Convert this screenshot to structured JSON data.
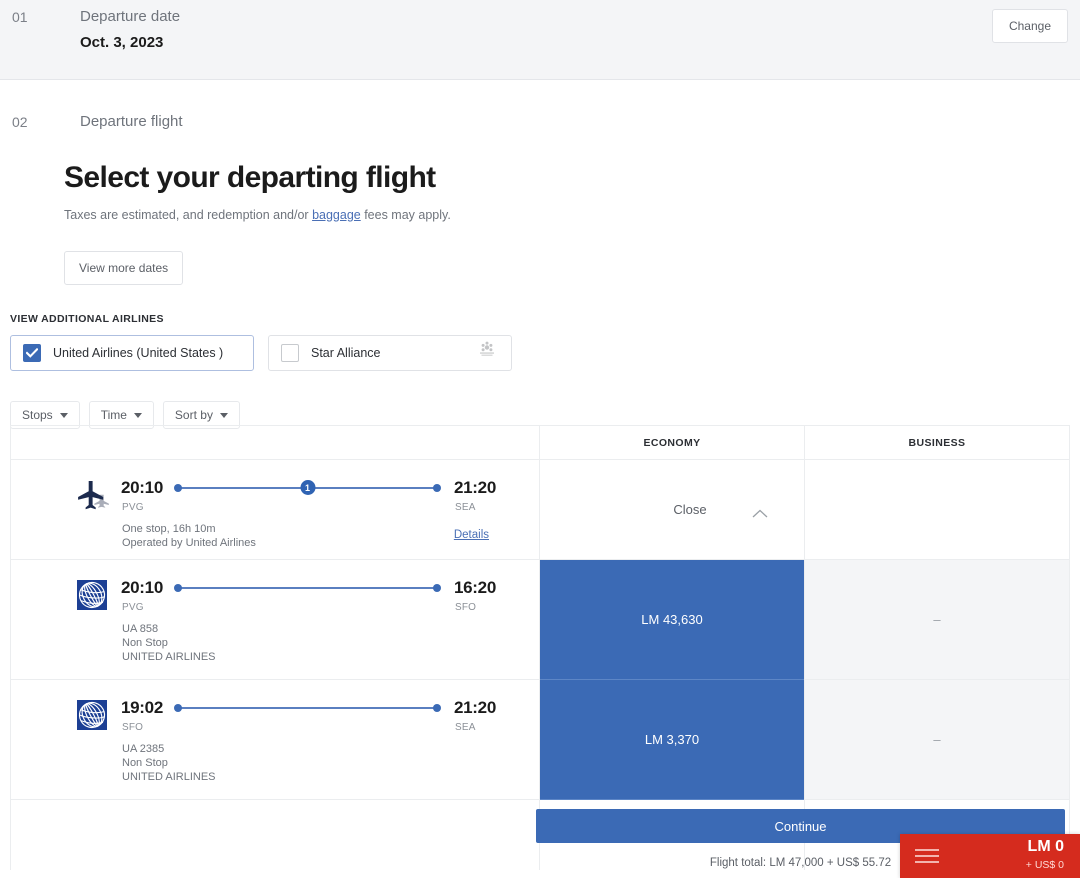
{
  "step1": {
    "number": "01",
    "label": "Departure date",
    "value": "Oct. 3, 2023",
    "change_label": "Change"
  },
  "step2": {
    "number": "02",
    "label": "Departure flight"
  },
  "main": {
    "title": "Select your departing flight",
    "subtitle_before": "Taxes are estimated, and redemption and/or ",
    "subtitle_link": "baggage",
    "subtitle_after": " fees may apply.",
    "view_more_dates": "View more dates"
  },
  "airlines": {
    "caption": "VIEW ADDITIONAL AIRLINES",
    "options": [
      {
        "label": "United Airlines (United States )",
        "checked": true,
        "logo": ""
      },
      {
        "label": "Star Alliance",
        "checked": false,
        "logo": "star-alliance-logo"
      }
    ]
  },
  "filters": [
    {
      "label": "Stops"
    },
    {
      "label": "Time"
    },
    {
      "label": "Sort by"
    }
  ],
  "table": {
    "cabins": [
      "ECONOMY",
      "BUSINESS"
    ],
    "rows": [
      {
        "type": "itinerary",
        "icon": "airplane-pair-icon",
        "depart_time": "20:10",
        "depart_code": "PVG",
        "arrive_time": "21:20",
        "arrive_code": "SEA",
        "stops_badge": "1",
        "meta_line1": "One stop, 16h 10m",
        "meta_line2": "Operated by United Airlines",
        "details_label": "Details",
        "economy": "",
        "business": "",
        "close_label": "Close"
      },
      {
        "type": "segment",
        "icon": "united-airlines-logo",
        "depart_time": "20:10",
        "depart_code": "PVG",
        "arrive_time": "16:20",
        "arrive_code": "SFO",
        "meta_line1": "UA 858",
        "meta_line2": "Non Stop",
        "meta_line3": "UNITED AIRLINES",
        "economy": "LM 43,630",
        "business": "–"
      },
      {
        "type": "segment",
        "icon": "united-airlines-logo",
        "depart_time": "19:02",
        "depart_code": "SFO",
        "arrive_time": "21:20",
        "arrive_code": "SEA",
        "meta_line1": "UA 2385",
        "meta_line2": "Non Stop",
        "meta_line3": "UNITED AIRLINES",
        "economy": "LM 3,370",
        "business": "–"
      }
    ]
  },
  "footer": {
    "continue_label": "Continue",
    "flight_total": "Flight total: LM 47,000 + US$ 55.72"
  },
  "cart": {
    "menu_icon": "hamburger-menu-icon",
    "amount": "LM 0",
    "secondary": "+ US$ 0"
  },
  "colors": {
    "accent_blue": "#3b6ab5",
    "cart_red": "#d52b1e",
    "band_gray": "#f4f5f7"
  }
}
